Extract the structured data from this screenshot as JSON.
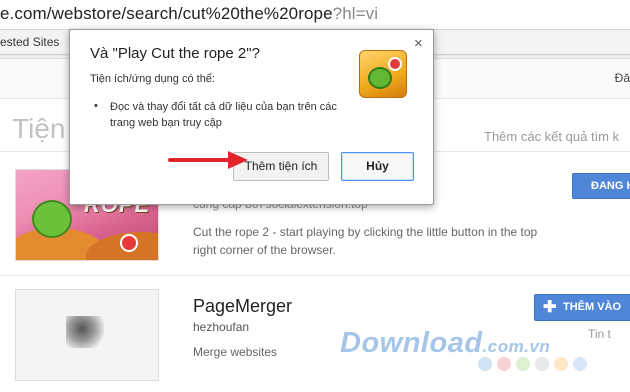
{
  "browser": {
    "url_main": "e.com/webstore/search/cut%20the%20rope",
    "url_query": "?hl=vi",
    "bookmark_text": "ested Sites"
  },
  "store": {
    "top_right_text": "Đă",
    "section_title": "Tiện",
    "more_results": "Thêm các kết quả tìm k"
  },
  "results": [
    {
      "thumb_text": "ROPE",
      "tagline": "cung cấp bởi socialextension.top",
      "description": "Cut the rope 2 - start playing by clicking the little button in the top right corner of the browser.",
      "button_label": "ĐANG K"
    },
    {
      "name": "PageMerger",
      "author": "hezhoufan",
      "description": "Merge websites",
      "button_label": "THÊM VÀO",
      "free_label": "Tin t"
    }
  ],
  "dialog": {
    "title": "Và \"Play Cut the rope 2\"?",
    "close_glyph": "×",
    "subtitle": "Tiện ích/ứng dụng có thể:",
    "bullet": "•",
    "permission": "Đọc và thay đổi tất cả dữ liệu của bạn trên các trang web bạn truy cập",
    "add_button": "Thêm tiện ích",
    "cancel_button": "Hủy",
    "icon": "cut-the-rope-icon"
  },
  "watermark": {
    "brand": "Download",
    "domain": ".com.vn",
    "dot_colors": [
      "#cfe3f5",
      "#f8d3d3",
      "#dff0d0",
      "#e8e8e8",
      "#fde7c8",
      "#d8e6f7"
    ]
  },
  "colors": {
    "accent_blue": "#4f86d8",
    "arrow_red": "#e0252b"
  }
}
